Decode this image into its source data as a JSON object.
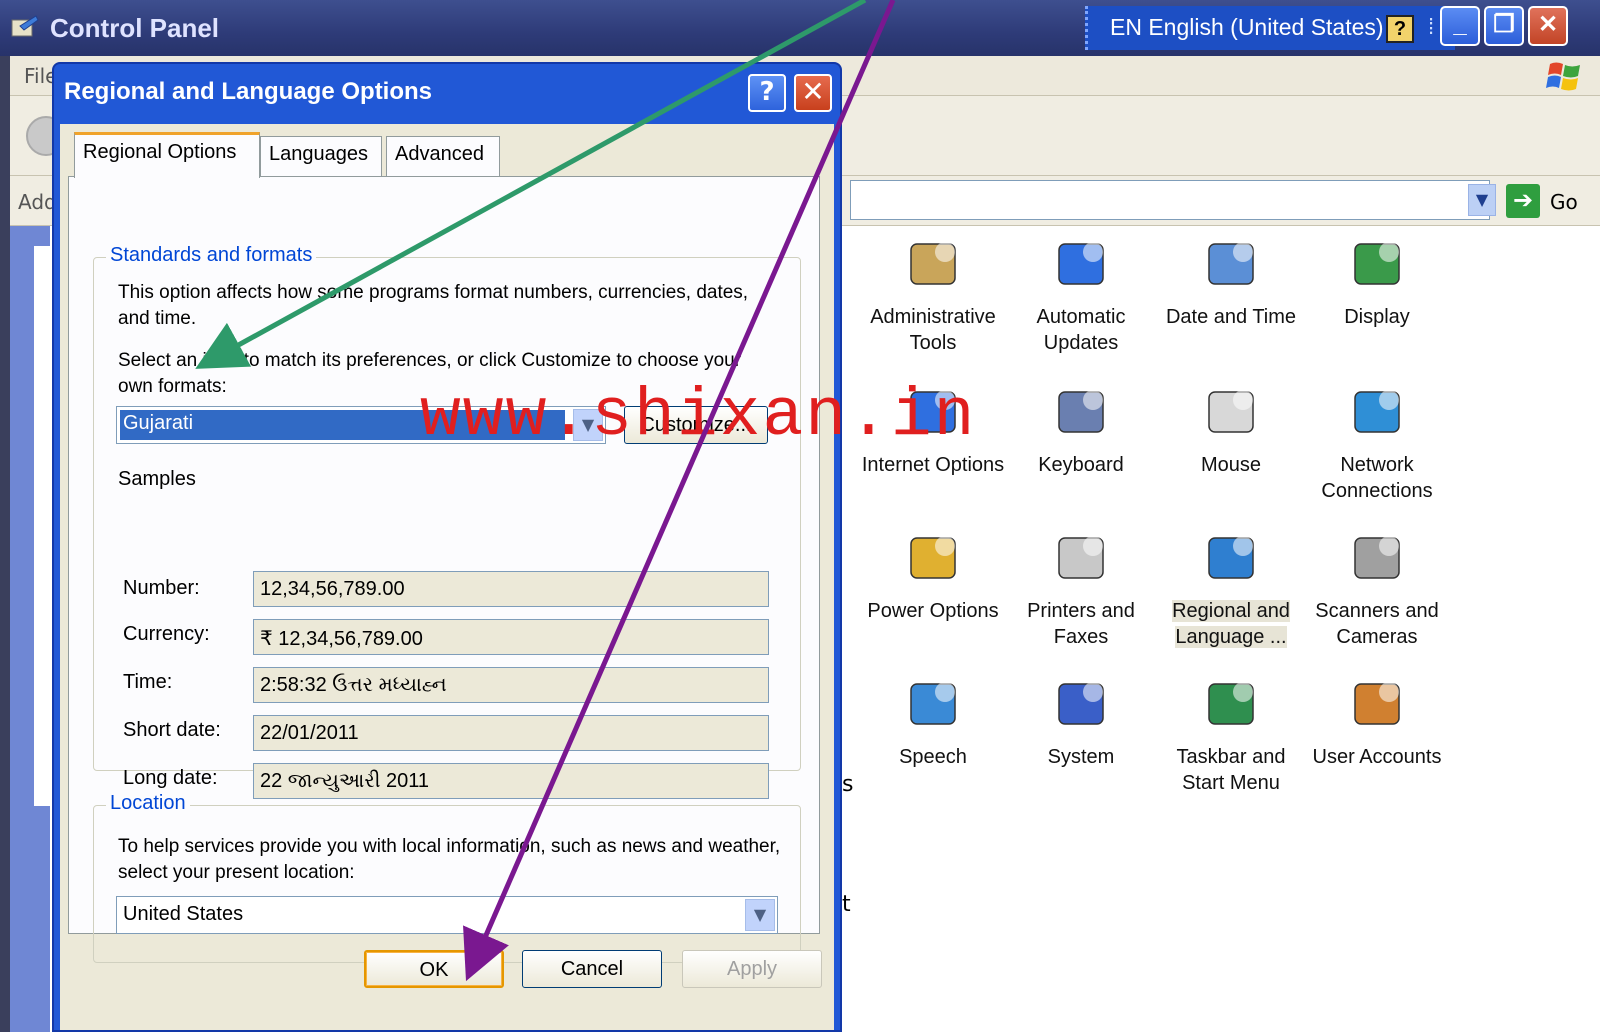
{
  "window": {
    "title": "Control Panel",
    "language_bar": "EN English (United States)",
    "help_glyph": "?",
    "min_glyph": "_",
    "restore_glyph": "❐",
    "close_glyph": "✕"
  },
  "menubar": {
    "file": "File"
  },
  "addressbar": {
    "label": "Address",
    "go": "Go"
  },
  "control_panel_items": [
    {
      "label": "Administrative Tools",
      "icon": "administrative-tools-icon"
    },
    {
      "label": "Automatic Updates",
      "icon": "automatic-updates-icon"
    },
    {
      "label": "Date and Time",
      "icon": "date-time-icon"
    },
    {
      "label": "Display",
      "icon": "display-icon"
    },
    {
      "label": "Internet Options",
      "icon": "internet-options-icon"
    },
    {
      "label": "Keyboard",
      "icon": "keyboard-icon"
    },
    {
      "label": "Mouse",
      "icon": "mouse-icon"
    },
    {
      "label": "Network Connections",
      "icon": "network-connections-icon"
    },
    {
      "label": "Power Options",
      "icon": "power-options-icon"
    },
    {
      "label": "Printers and Faxes",
      "icon": "printers-icon"
    },
    {
      "label": "Regional and Language ...",
      "icon": "regional-language-icon",
      "selected": true
    },
    {
      "label": "Scanners and Cameras",
      "icon": "scanners-icon"
    },
    {
      "label": "Speech",
      "icon": "speech-icon"
    },
    {
      "label": "System",
      "icon": "system-icon"
    },
    {
      "label": "Taskbar and Start Menu",
      "icon": "taskbar-icon"
    },
    {
      "label": "User Accounts",
      "icon": "user-accounts-icon"
    }
  ],
  "stray_text": {
    "s": "s",
    "t": "t"
  },
  "dialog": {
    "title": "Regional and Language Options",
    "help": "?",
    "close": "✕",
    "tabs": [
      "Regional Options",
      "Languages",
      "Advanced"
    ],
    "standards": {
      "legend": "Standards and formats",
      "desc": "This option affects how some programs format numbers, currencies, dates, and time.",
      "instruction": "Select an item to match its preferences, or click Customize to choose your own formats:",
      "selected_format": "Gujarati",
      "customize": "Customize...",
      "samples_label": "Samples",
      "samples": [
        {
          "label": "Number:",
          "value": "12,34,56,789.00"
        },
        {
          "label": "Currency:",
          "value": "₹ 12,34,56,789.00"
        },
        {
          "label": "Time:",
          "value": "2:58:32 ઉત્તર મધ્યાહ્ન"
        },
        {
          "label": "Short date:",
          "value": "22/01/2011"
        },
        {
          "label": "Long date:",
          "value": "22 જાન્યુઆરી 2011"
        }
      ]
    },
    "location": {
      "legend": "Location",
      "desc": "To help services provide you with local information, such as news and weather, select your present location:",
      "value": "United States"
    },
    "buttons": {
      "ok": "OK",
      "cancel": "Cancel",
      "apply": "Apply"
    }
  },
  "watermark": "www.shixan.in",
  "colors": {
    "accent_arrow_green": "#2e9a6a",
    "accent_arrow_purple": "#7a1890",
    "watermark": "#e01f1f"
  }
}
